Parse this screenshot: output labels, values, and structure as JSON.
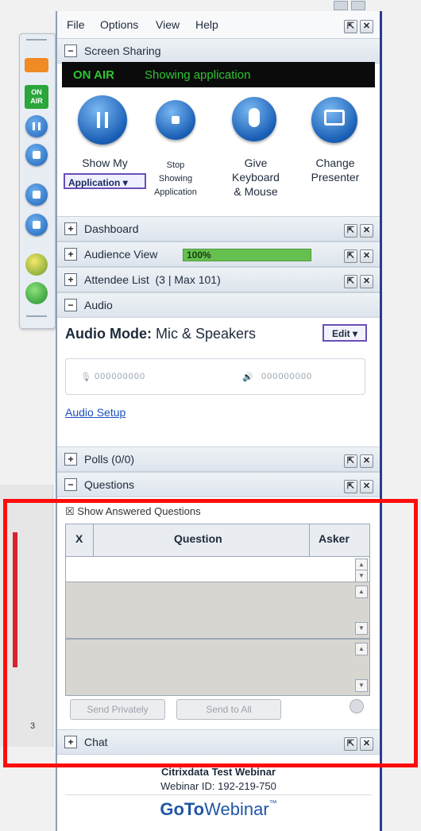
{
  "menu": [
    "File",
    "Options",
    "View",
    "Help"
  ],
  "screen_sharing": {
    "title": "Screen Sharing",
    "status_on": "ON AIR",
    "status_text": "Showing application",
    "buttons": {
      "show_label": "Show My",
      "show_select": "Application",
      "stop_line1": "Stop",
      "stop_line2": "Showing",
      "stop_line3": "Application",
      "give_line1": "Give",
      "give_line2": "Keyboard",
      "give_line3": "& Mouse",
      "change_line1": "Change",
      "change_line2": "Presenter"
    }
  },
  "mini_toolbar": {
    "on_air_line1": "ON",
    "on_air_line2": "AIR"
  },
  "dashboard": {
    "title": "Dashboard"
  },
  "audience_view": {
    "title": "Audience View",
    "percent_label": "100%",
    "percent": 100
  },
  "attendee_list": {
    "title": "Attendee List",
    "count": "(3 | Max 101)"
  },
  "audio": {
    "title": "Audio",
    "mode_label": "Audio Mode:",
    "mode_value": "Mic & Speakers",
    "edit": "Edit",
    "mic_meter": "000000000",
    "speaker_meter": "000000000",
    "setup_link": "Audio Setup"
  },
  "polls": {
    "title": "Polls (0/0)"
  },
  "questions": {
    "title": "Questions",
    "show_answered": "Show Answered Questions",
    "col_x": "X",
    "col_question": "Question",
    "col_asker": "Asker",
    "send_private": "Send Privately",
    "send_all": "Send to All"
  },
  "chat": {
    "title": "Chat"
  },
  "background": {
    "page_num": "3"
  },
  "footer": {
    "webinar_name": "Citrixdata Test Webinar",
    "webinar_id": "Webinar ID: 192-219-750",
    "logo_goto": "GoTo",
    "logo_webinar": "Webinar",
    "logo_tm": "™"
  },
  "colors": {
    "highlight": "#ff0d0d",
    "on_air": "#2ec533",
    "accent": "#1a5fb6"
  }
}
